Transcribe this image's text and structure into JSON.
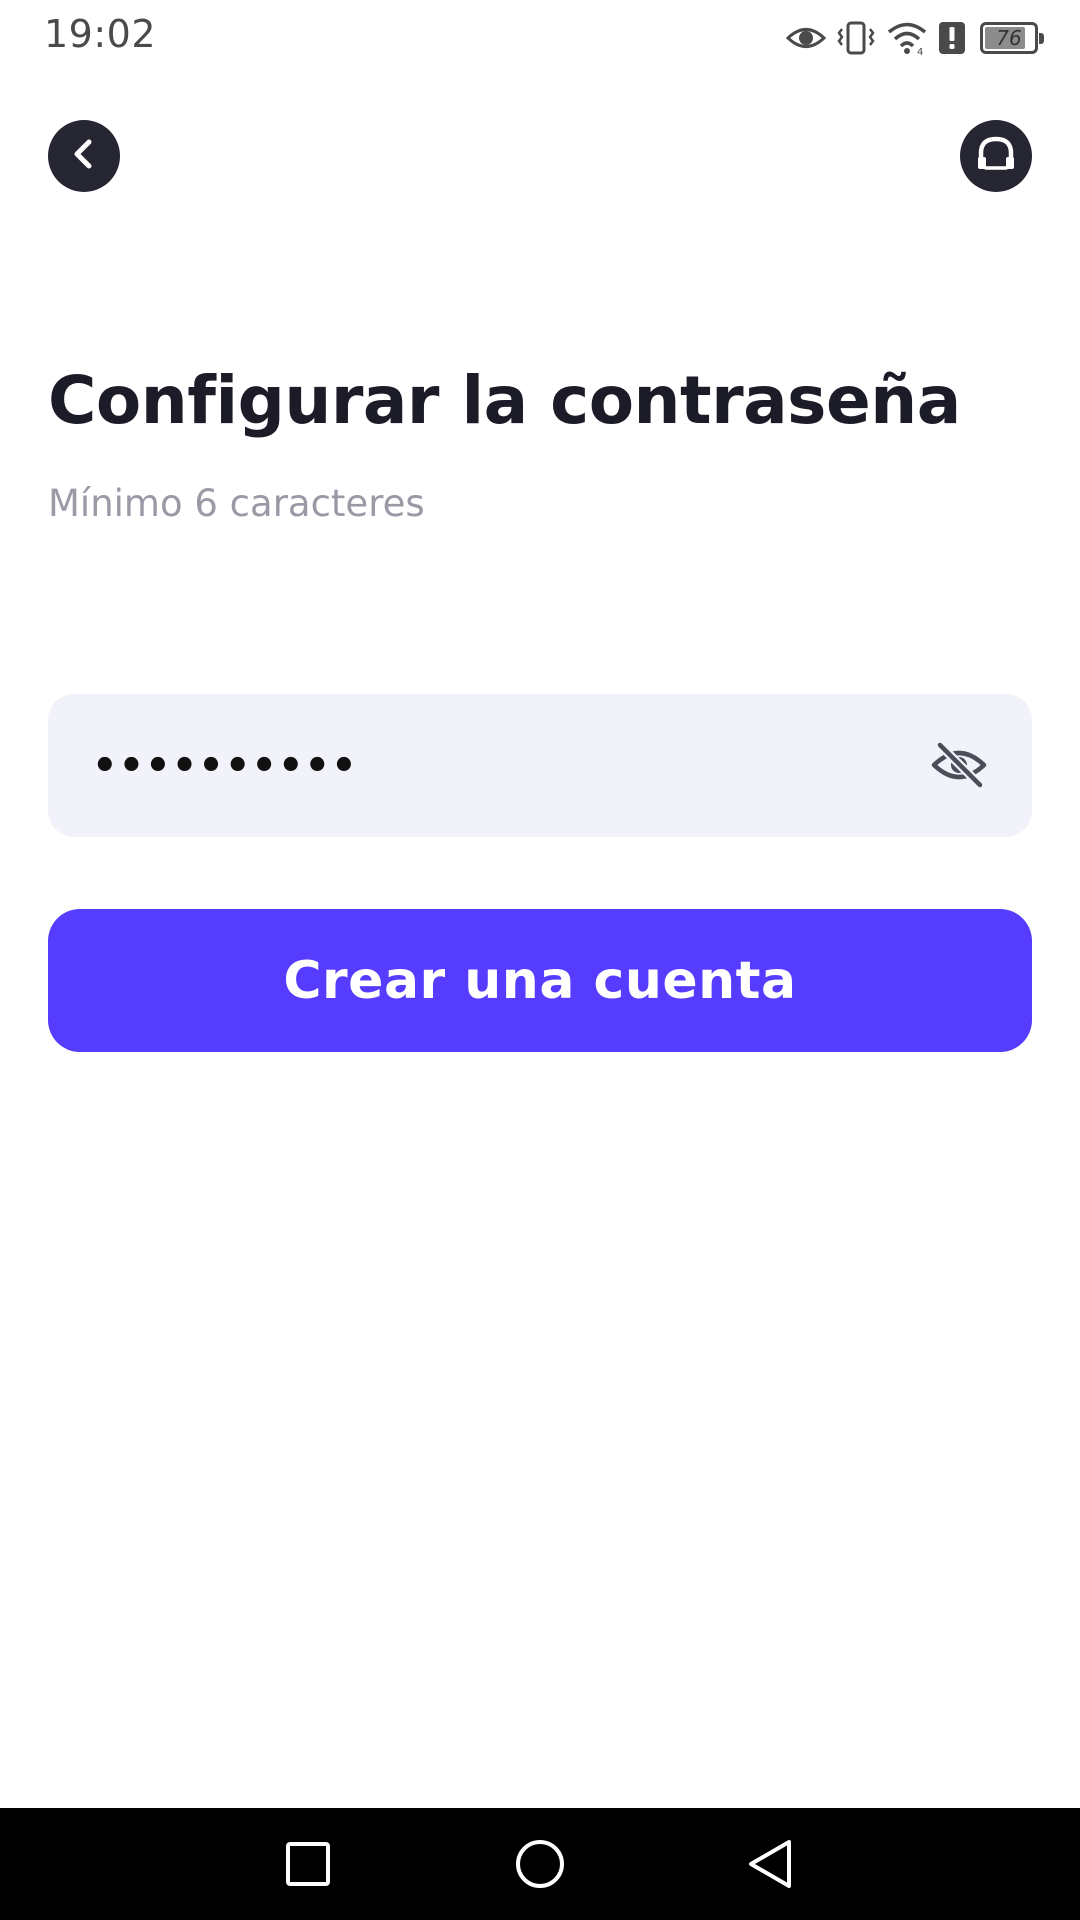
{
  "status_bar": {
    "time": "19:02",
    "battery_level": "76",
    "icons": [
      "eye-icon",
      "vibrate-icon",
      "wifi-icon",
      "alert-icon",
      "battery-icon"
    ]
  },
  "header": {
    "back_icon": "chevron-left-icon",
    "support_icon": "headset-icon"
  },
  "main": {
    "title": "Configurar la contraseña",
    "subtitle": "Mínimo 6 caracteres",
    "password_field": {
      "value": "••••••••••",
      "visibility_icon": "eye-off-icon"
    },
    "create_button_label": "Crear una cuenta"
  },
  "nav_bar": {
    "items": [
      "recents-icon",
      "home-icon",
      "back-triangle-icon"
    ]
  },
  "colors": {
    "accent": "#553cff",
    "field_background": "#f2f2fb",
    "header_button": "#262633",
    "title": "#1c1c28",
    "subtitle": "#9a9aa6"
  }
}
